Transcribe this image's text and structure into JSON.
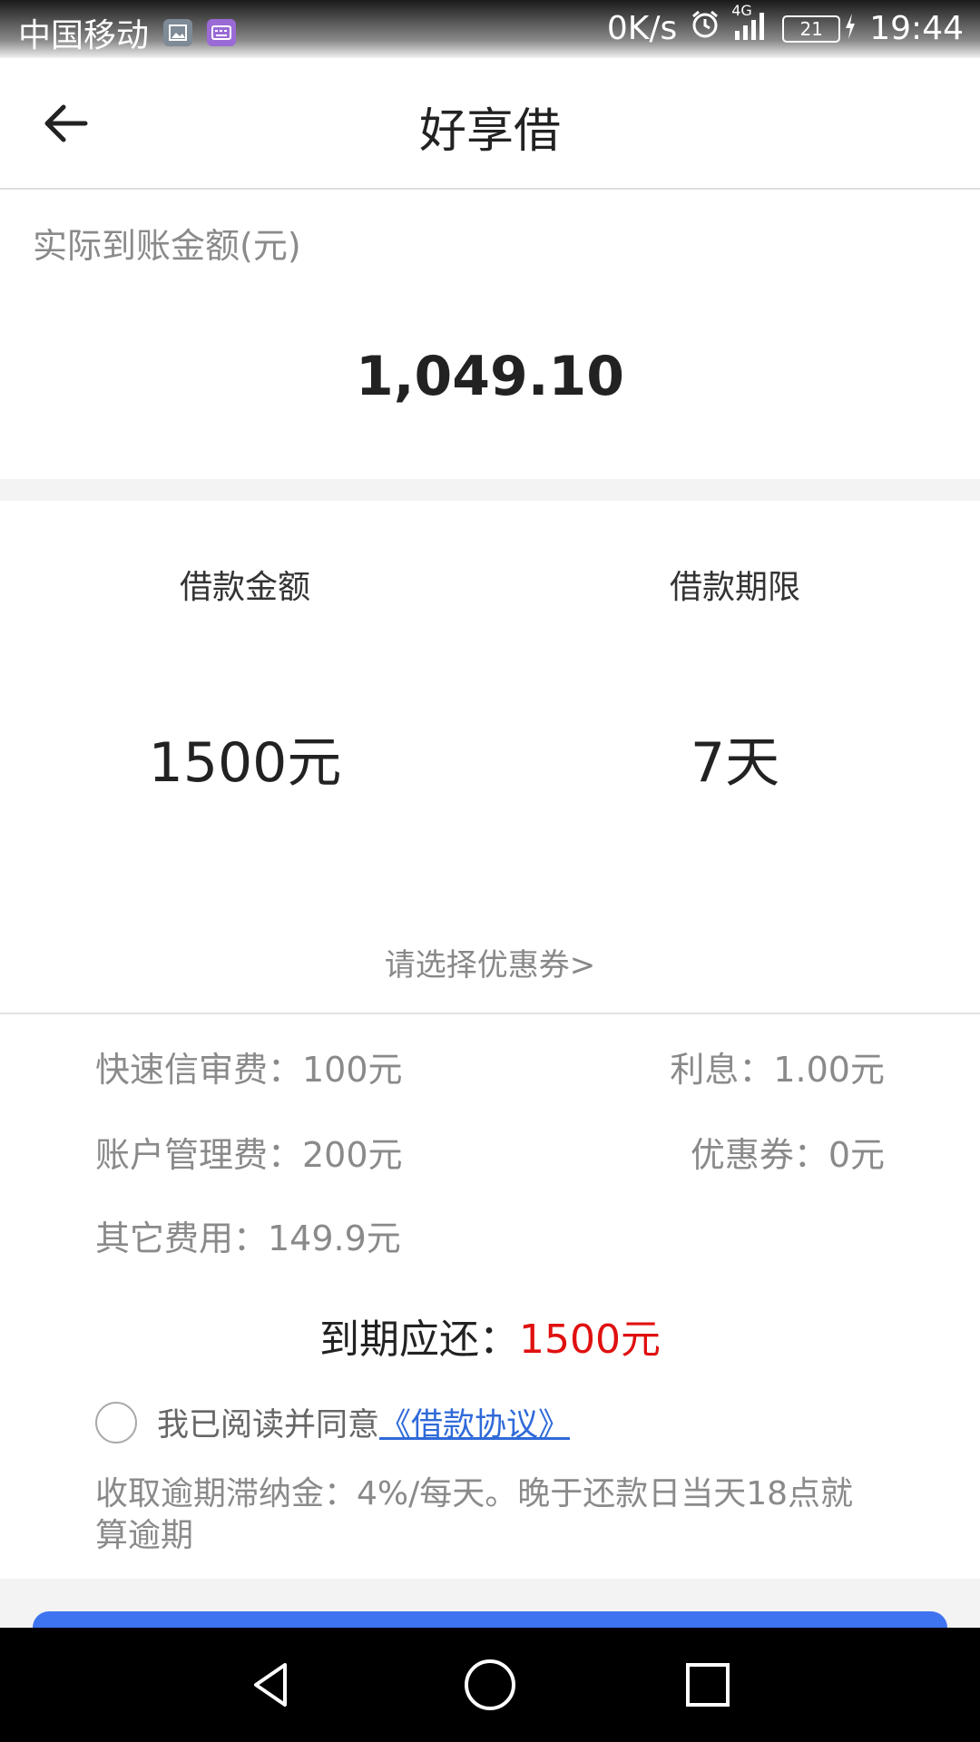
{
  "status_bar": {
    "carrier": "中国移动",
    "net_speed": "0K/s",
    "network": "4G",
    "battery_level": "21",
    "time": "19:44"
  },
  "app_bar": {
    "title": "好享借"
  },
  "amount": {
    "label": "实际到账金额(元)",
    "value": "1,049.10"
  },
  "loan": {
    "amount_label": "借款金额",
    "amount_value": "1500元",
    "term_label": "借款期限",
    "term_value": "7天",
    "coupon_link": "请选择优惠券>"
  },
  "fees": {
    "quick_review": "快速信审费：100元",
    "interest": "利息：1.00元",
    "account_mgmt": "账户管理费：200元",
    "coupon": "优惠券：0元",
    "other": "其它费用：149.9元",
    "due_label": "到期应还：",
    "due_amount": "1500元"
  },
  "agreement": {
    "text": "我已阅读并同意",
    "link": "《借款协议》"
  },
  "late_note": "收取逾期滞纳金：4%/每天。晚于还款日当天18点就算逾期",
  "colors": {
    "accent": "#3f74f0",
    "due": "#e01010",
    "link": "#2f6ad9"
  }
}
